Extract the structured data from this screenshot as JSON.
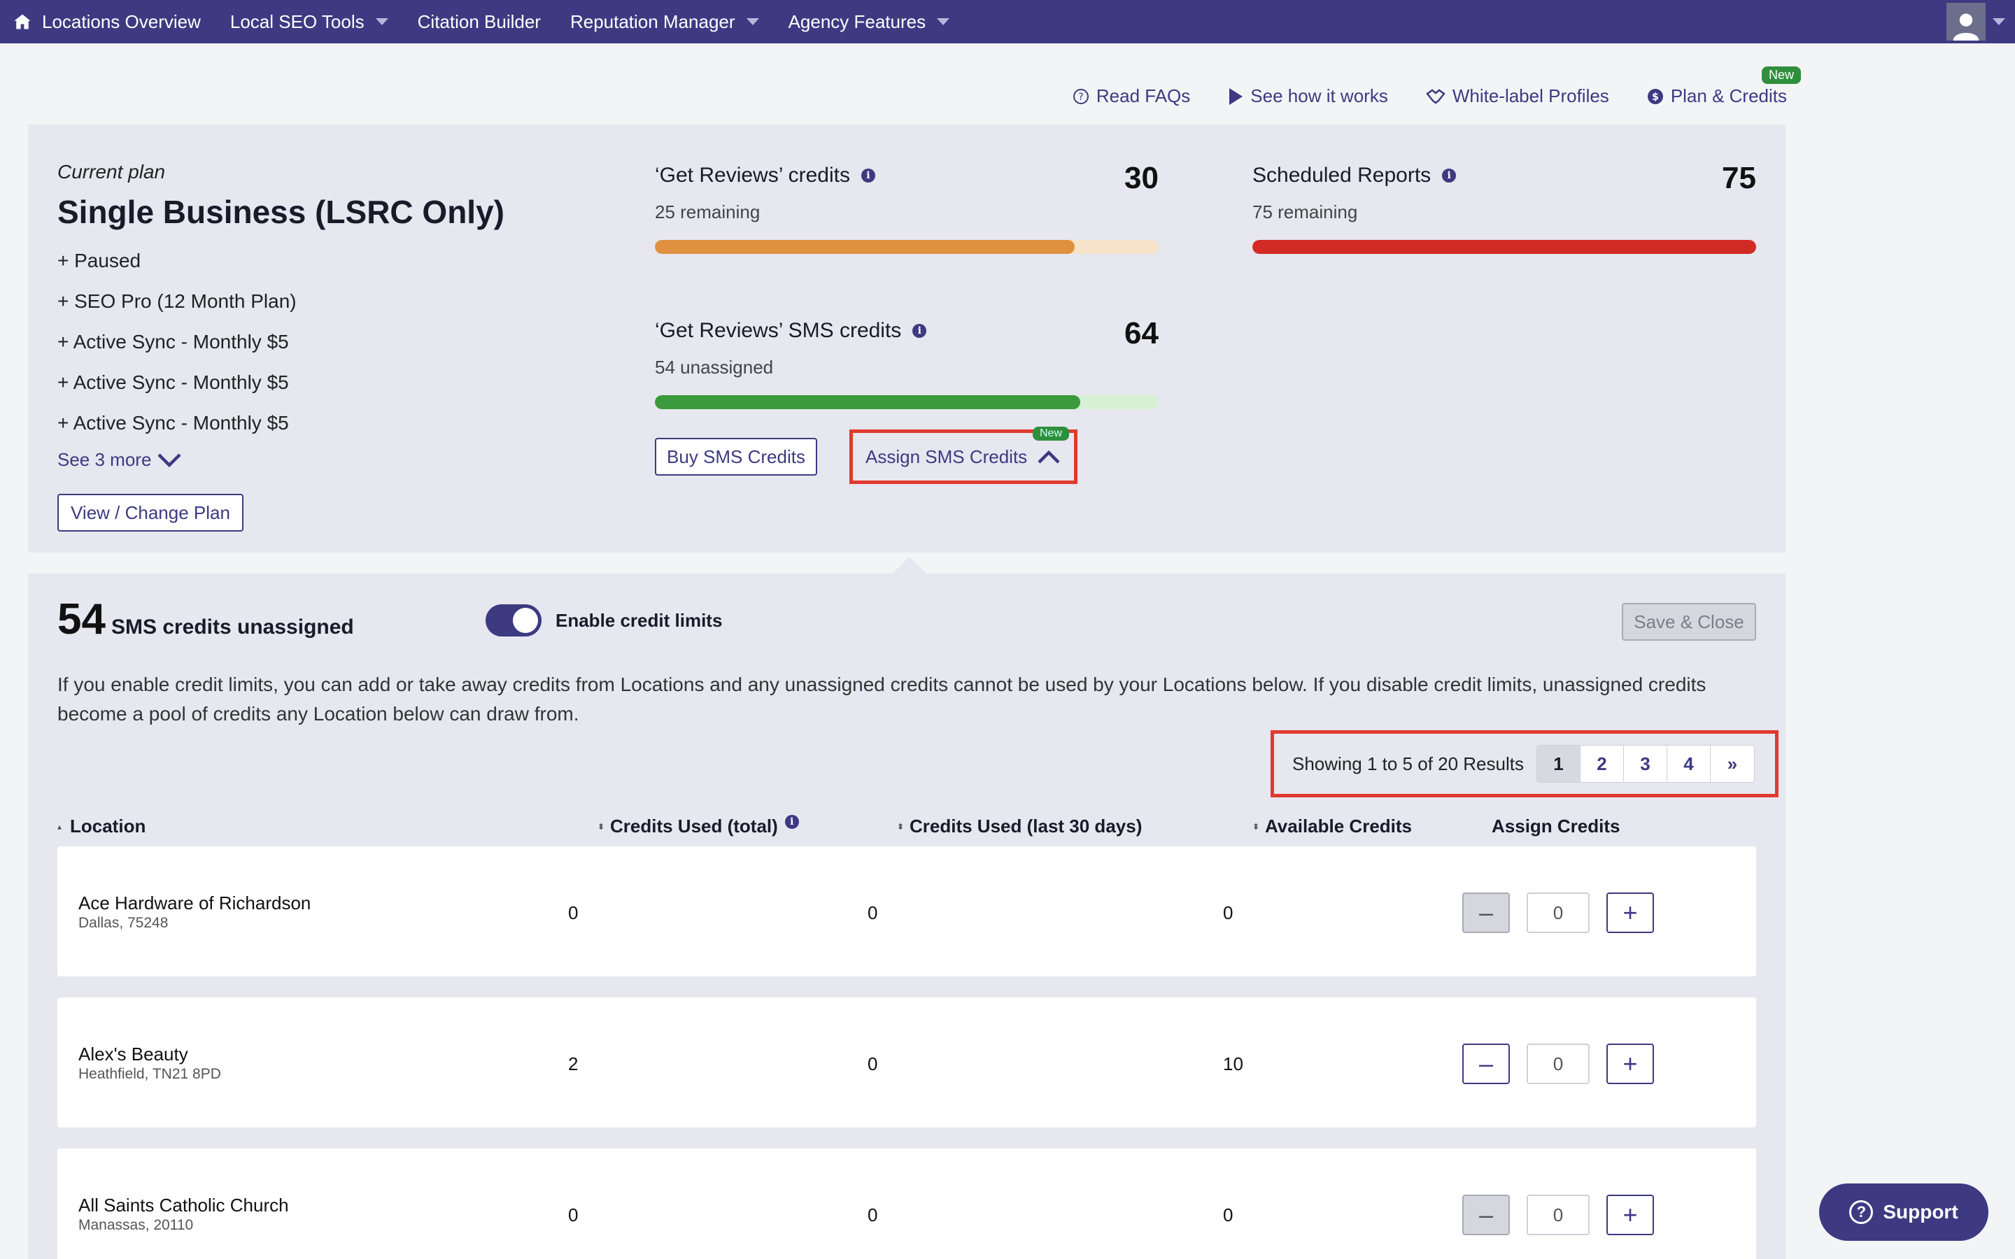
{
  "nav": {
    "items": [
      {
        "label": "Locations Overview",
        "dropdown": false
      },
      {
        "label": "Local SEO Tools",
        "dropdown": true
      },
      {
        "label": "Citation Builder",
        "dropdown": false
      },
      {
        "label": "Reputation Manager",
        "dropdown": true
      },
      {
        "label": "Agency Features",
        "dropdown": true
      }
    ]
  },
  "sublinks": {
    "faqs": "Read FAQs",
    "how": "See how it works",
    "white_label": "White-label Profiles",
    "plan": "Plan & Credits",
    "new_badge": "New"
  },
  "plan": {
    "current_label": "Current plan",
    "name": "Single Business (LSRC Only)",
    "addons": [
      "+ Paused",
      "+ SEO Pro (12 Month Plan)",
      "+ Active Sync - Monthly $5",
      "+ Active Sync - Monthly $5",
      "+ Active Sync - Monthly $5"
    ],
    "see_more": "See 3 more",
    "view_change": "View / Change Plan"
  },
  "credits": {
    "reviews": {
      "title": "‘Get Reviews’ credits",
      "value": "30",
      "sub": "25 remaining",
      "fill_fraction": 0.833,
      "color": "#e0913f",
      "track": "#f6e3c9"
    },
    "sms": {
      "title": "‘Get Reviews’ SMS credits",
      "value": "64",
      "sub": "54 unassigned",
      "fill_fraction": 0.844,
      "color": "#3b9a3c",
      "track": "#d6f0d4"
    },
    "reports": {
      "title": "Scheduled Reports",
      "value": "75",
      "sub": "75 remaining",
      "fill_fraction": 1.0,
      "color": "#d22a25",
      "track": "#f6d0cf"
    },
    "buy_sms": "Buy SMS Credits",
    "assign_sms": "Assign SMS Credits",
    "new_badge": "New"
  },
  "assign": {
    "count": "54",
    "count_label": "SMS credits unassigned",
    "toggle_label": "Enable credit limits",
    "toggle_on": true,
    "save_close": "Save & Close",
    "description": "If you enable credit limits, you can add or take away credits from Locations and any unassigned credits cannot be used by your Locations below. If you disable credit limits, unassigned credits become a pool of credits any Location below can draw from.",
    "pager_text": "Showing 1 to 5 of 20 Results",
    "pages": [
      "1",
      "2",
      "3",
      "4",
      "»"
    ],
    "columns": {
      "location": "Location",
      "used_total": "Credits Used (total)",
      "used_30": "Credits Used (last 30 days)",
      "available": "Available Credits",
      "assign": "Assign Credits"
    },
    "rows": [
      {
        "name": "Ace Hardware of Richardson",
        "address": "Dallas, 75248",
        "used_total": "0",
        "used_30": "0",
        "available": "0",
        "assign": "0",
        "minus_disabled": true
      },
      {
        "name": "Alex's Beauty",
        "address": "Heathfield, TN21 8PD",
        "used_total": "2",
        "used_30": "0",
        "available": "10",
        "assign": "0",
        "minus_disabled": false
      },
      {
        "name": "All Saints Catholic Church",
        "address": "Manassas, 20110",
        "used_total": "0",
        "used_30": "0",
        "available": "0",
        "assign": "0",
        "minus_disabled": true
      }
    ]
  },
  "support": "Support"
}
